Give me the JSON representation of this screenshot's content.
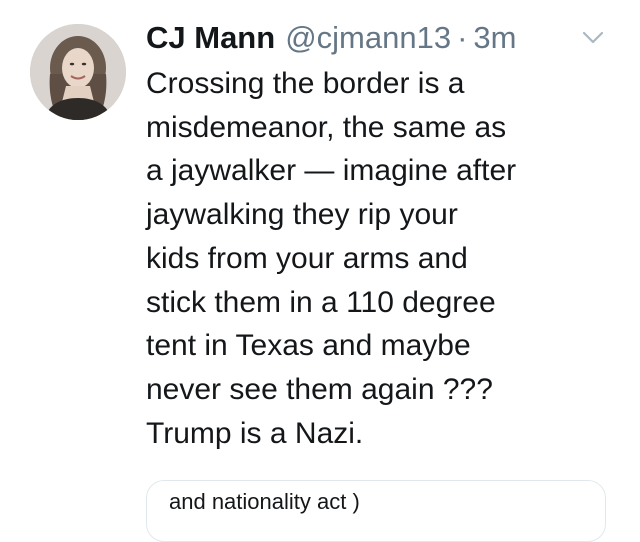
{
  "tweet": {
    "display_name": "CJ Mann",
    "handle": "@cjmann13",
    "separator": "·",
    "timestamp": "3m",
    "menu_icon": "chevron-down-icon",
    "avatar_icon": "user-avatar",
    "text_lines": [
      "Crossing the border is a",
      "misdemeanor, the same as",
      "a jaywalker — imagine after",
      "jaywalking they rip your",
      "kids from your arms and",
      "stick them in a 110 degree",
      "tent in Texas and maybe",
      "never see them again ???",
      "Trump is a Nazi."
    ],
    "quoted_card": {
      "text_line": "and nationality act )"
    }
  },
  "colors": {
    "primary_text": "#14171a",
    "secondary_text": "#657786",
    "card_border": "#e1e8ed",
    "chevron": "#aab8c2"
  }
}
